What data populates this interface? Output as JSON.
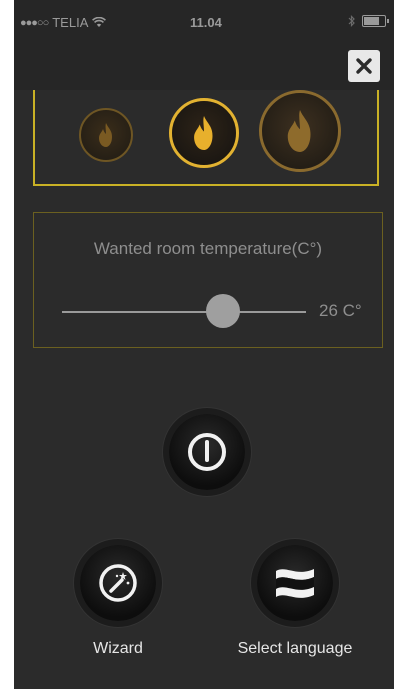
{
  "status_bar": {
    "signal_dots": "●●●○○",
    "carrier": "TELIA",
    "time": "11.04"
  },
  "header": {
    "close_icon": "close-icon"
  },
  "flame_selector": {
    "levels": [
      "small",
      "medium",
      "large"
    ],
    "selected_level": "medium",
    "accent_color": "#e2b231"
  },
  "temperature": {
    "title": "Wanted room temperature(C°)",
    "value_label": "26 C°",
    "slider_fraction": 0.66
  },
  "buttons": {
    "power_icon": "power-icon",
    "wizard_label": "Wizard",
    "wizard_icon": "magic-wand-icon",
    "language_label": "Select language",
    "language_icon": "flag-icon"
  }
}
